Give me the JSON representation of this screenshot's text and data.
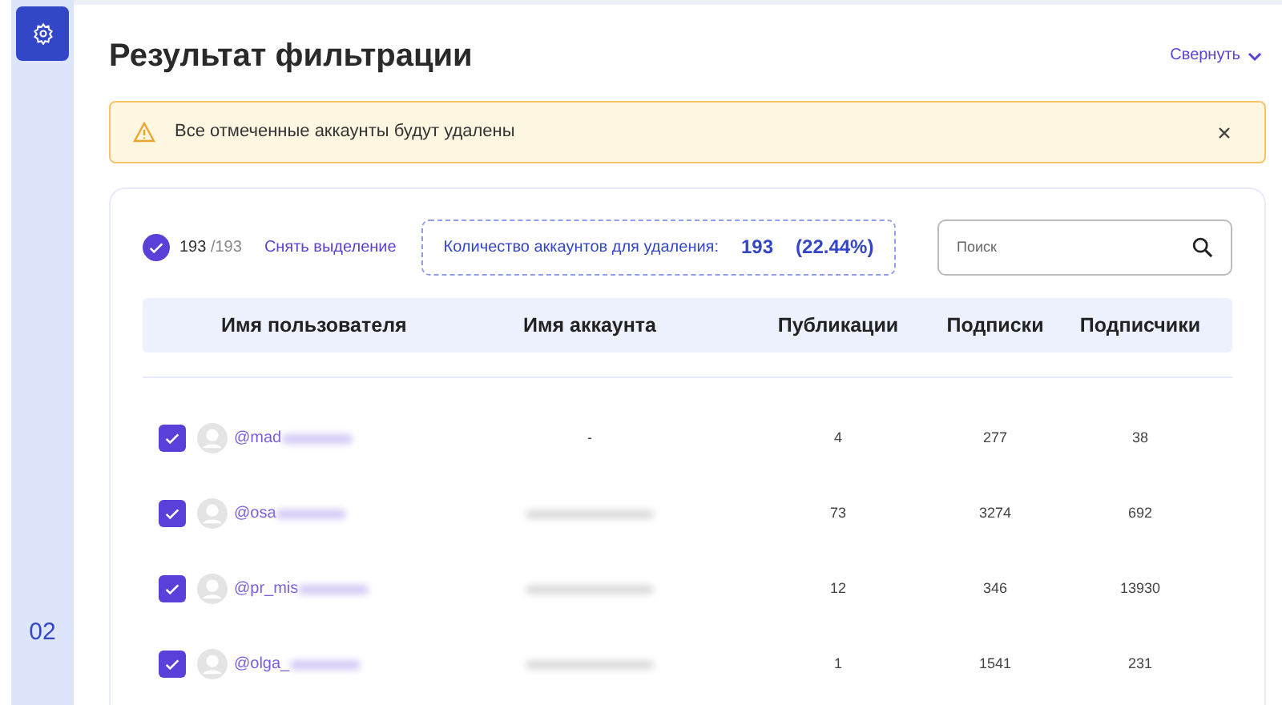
{
  "sidebar": {
    "page_number": "02"
  },
  "title": "Результат фильтрации",
  "collapse_link": "Свернуть",
  "alert": {
    "text": "Все отмеченные аккаунты будут удалены"
  },
  "selection": {
    "checked": true,
    "selected_count": "193",
    "total": "/193",
    "clear_link": "Снять выделение"
  },
  "deletion_summary": {
    "label": "Количество аккаунтов для удаления:",
    "count": "193",
    "percent": "(22.44%)"
  },
  "search": {
    "placeholder": "Поиск"
  },
  "table": {
    "columns": [
      "Имя пользователя",
      "Имя аккаунта",
      "Публикации",
      "Подписки",
      "Подписчики"
    ],
    "rows": [
      {
        "checked": true,
        "username": "@mad",
        "username_blurred": true,
        "account_name": "-",
        "account_blurred": false,
        "posts": "4",
        "following": "277",
        "followers": "38"
      },
      {
        "checked": true,
        "username": "@osa",
        "username_blurred": true,
        "account_blurred": true,
        "posts": "73",
        "following": "3274",
        "followers": "692"
      },
      {
        "checked": true,
        "username": "@pr_mis",
        "username_blurred": true,
        "account_blurred": true,
        "posts": "12",
        "following": "346",
        "followers": "13930"
      },
      {
        "checked": true,
        "username": "@olga_",
        "username_blurred": true,
        "account_blurred": true,
        "posts": "1",
        "following": "1541",
        "followers": "231"
      }
    ]
  }
}
